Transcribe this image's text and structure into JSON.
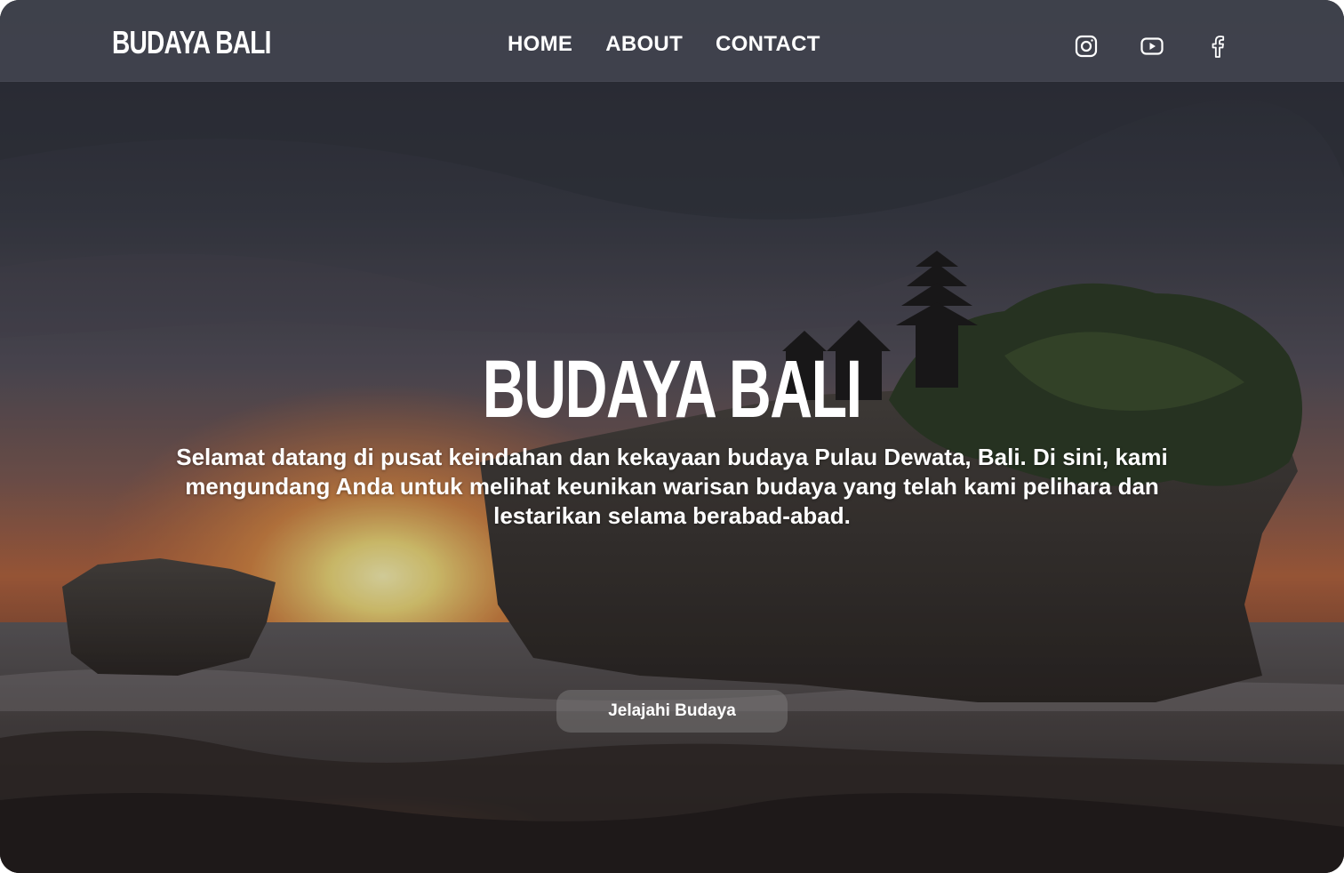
{
  "brand": {
    "name": "BUDAYA BALI"
  },
  "nav": {
    "links": [
      {
        "label": "HOME"
      },
      {
        "label": "ABOUT"
      },
      {
        "label": "CONTACT"
      }
    ]
  },
  "socials": [
    {
      "icon": "instagram-icon"
    },
    {
      "icon": "youtube-icon"
    },
    {
      "icon": "facebook-icon"
    }
  ],
  "hero": {
    "title": "BUDAYA BALI",
    "description": "Selamat datang di pusat keindahan dan kekayaan budaya Pulau Dewata, Bali. Di sini, kami mengundang Anda untuk melihat keunikan warisan budaya yang telah kami pelihara dan lestarikan selama berabad-abad.",
    "cta_label": "Jelajahi Budaya",
    "background": "temple-on-rock-at-sunset"
  },
  "colors": {
    "text": "#ffffff",
    "navbar_bg": "#525460",
    "sky_dark": "#2a2d36",
    "sunset_orange": "#e0733a",
    "sun_yellow": "#f6e58a"
  }
}
